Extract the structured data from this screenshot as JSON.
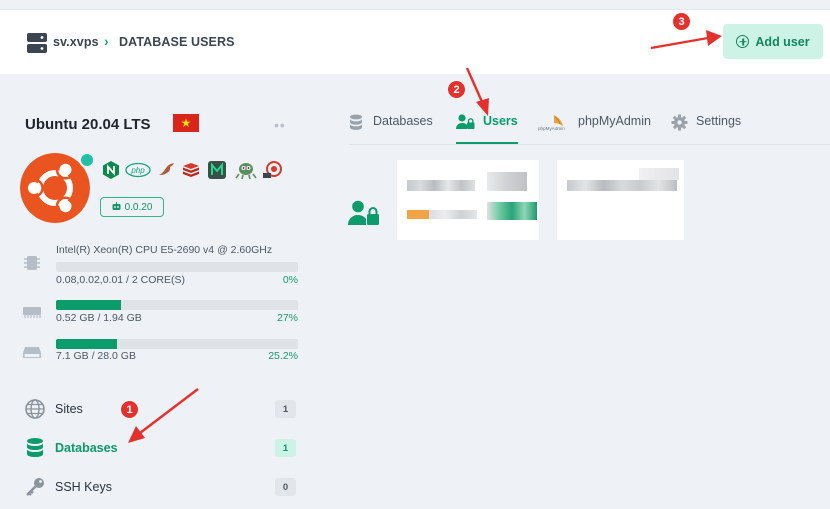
{
  "header": {
    "host": "sv.xvps",
    "separator": ">",
    "page": "DATABASE USERS",
    "add_user_label": "Add user"
  },
  "server": {
    "os_name": "Ubuntu 20.04 LTS",
    "flag_glyph": "★",
    "more": "••",
    "agent_version": "0.0.20",
    "tech_icons": [
      "nginx-icon",
      "php-icon",
      "mariadb-icon",
      "redis-icon",
      "memcached-icon",
      "supervisor-icon",
      "fail2ban-icon"
    ]
  },
  "stats": {
    "cpu_model": "Intel(R) Xeon(R) CPU E5-2690 v4 @ 2.60GHz",
    "cpu_load": "0.08,0.02,0.01 / 2 CORE(S)",
    "cpu_pct": "0%",
    "cpu_fraction": 0.0,
    "ram_label": "0.52 GB / 1.94 GB",
    "ram_pct": "27%",
    "ram_fraction": 0.27,
    "disk_label": "7.1 GB / 28.0 GB",
    "disk_pct": "25.2%",
    "disk_fraction": 0.252
  },
  "nav": [
    {
      "label": "Sites",
      "count": "1",
      "icon": "globe-icon",
      "active": false
    },
    {
      "label": "Databases",
      "count": "1",
      "icon": "database-icon",
      "active": true
    },
    {
      "label": "SSH Keys",
      "count": "0",
      "icon": "key-icon",
      "active": false
    }
  ],
  "tabs": [
    {
      "label": "Databases",
      "icon": "database-icon"
    },
    {
      "label": "Users",
      "icon": "user-lock-icon",
      "active": true
    },
    {
      "label": "phpMyAdmin",
      "icon": "phpmyadmin-icon"
    },
    {
      "label": "Settings",
      "icon": "gear-icon"
    }
  ],
  "callouts": [
    "1",
    "2",
    "3"
  ],
  "colors": {
    "accent": "#0c9b6a",
    "accent_light": "#cdf3e6",
    "callout_red": "#e5312e",
    "ubuntu_orange": "#e95420"
  }
}
